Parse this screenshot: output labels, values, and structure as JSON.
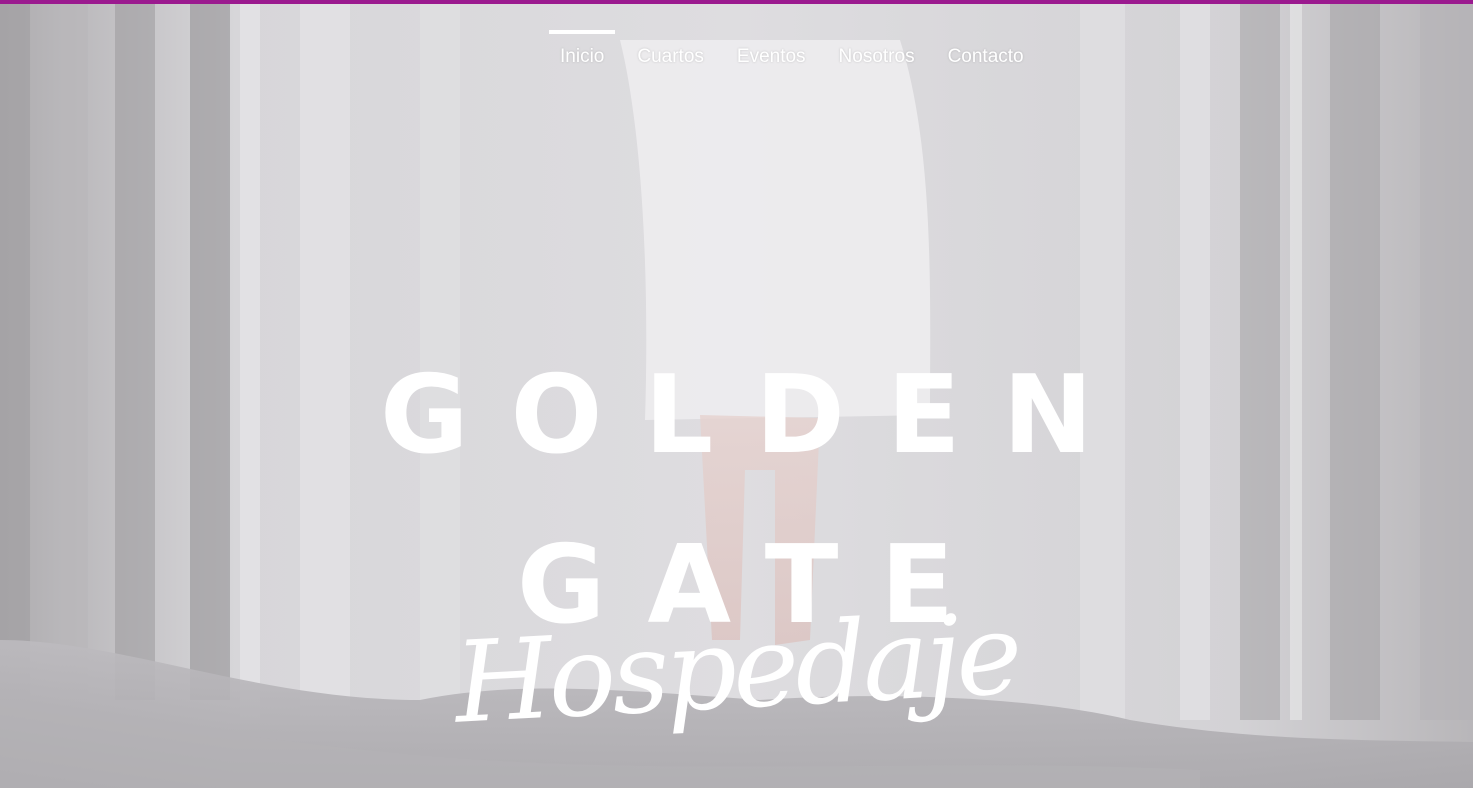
{
  "brand": {
    "accent_color": "#9b1a8f"
  },
  "nav": {
    "items": [
      {
        "label": "Inicio",
        "active": true
      },
      {
        "label": "Cuartos",
        "active": false
      },
      {
        "label": "Eventos",
        "active": false
      },
      {
        "label": "Nosotros",
        "active": false
      },
      {
        "label": "Contacto",
        "active": false
      }
    ]
  },
  "hero": {
    "title_line_1": "GOLDEN",
    "title_line_2": "GATE",
    "script_text": "Hospedaje",
    "background_icon": "curtains-bedroom-photo"
  }
}
